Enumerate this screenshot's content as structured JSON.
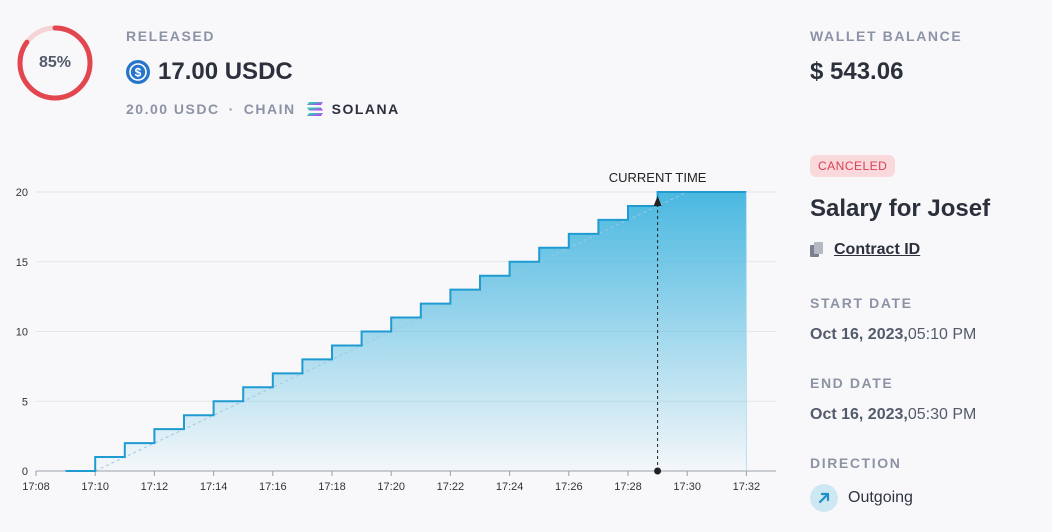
{
  "progress": {
    "percent": 85,
    "label": "85%",
    "color": "#e2474f",
    "track_color": "#f6d4d6"
  },
  "released": {
    "label": "RELEASED",
    "amount": "17.00 USDC",
    "icon": "usdc-icon",
    "total": "20.00 USDC",
    "separator": "·",
    "chain_label": "CHAIN",
    "chain_icon": "solana-icon",
    "chain_name": "SOLANA"
  },
  "wallet": {
    "label": "WALLET BALANCE",
    "value": "$ 543.06"
  },
  "stream": {
    "status": "CANCELED",
    "title": "Salary for Josef",
    "contract_label": "Contract ID",
    "contract_icon": "copy-icon",
    "start_label": "START DATE",
    "start_date": "Oct 16, 2023,",
    "start_time": "05:10 PM",
    "end_label": "END DATE",
    "end_date": "Oct 16, 2023,",
    "end_time": "05:30 PM",
    "direction_label": "DIRECTION",
    "direction_icon": "arrow-up-right-icon",
    "direction_value": "Outgoing"
  },
  "chart_data": {
    "type": "area",
    "title": "",
    "xlabel": "",
    "ylabel": "",
    "x_ticks": [
      "17:08",
      "17:10",
      "17:12",
      "17:14",
      "17:16",
      "17:18",
      "17:20",
      "17:22",
      "17:24",
      "17:26",
      "17:28",
      "17:30",
      "17:32"
    ],
    "y_ticks": [
      0,
      5,
      10,
      15,
      20
    ],
    "xlim_minutes": [
      0,
      25
    ],
    "ylim": [
      0,
      20
    ],
    "x_start": "17:08",
    "series": [
      {
        "step_x": [
          "17:09",
          "17:10",
          "17:11",
          "17:12",
          "17:13",
          "17:14",
          "17:15",
          "17:16",
          "17:17",
          "17:18",
          "17:19",
          "17:20",
          "17:21",
          "17:22",
          "17:23",
          "17:24",
          "17:25",
          "17:26",
          "17:27",
          "17:28",
          "17:29",
          "17:30",
          "17:32"
        ],
        "step_y": [
          0,
          0,
          1,
          2,
          3,
          4,
          5,
          6,
          7,
          8,
          9,
          10,
          11,
          12,
          13,
          14,
          15,
          16,
          17,
          18,
          19,
          20,
          20
        ]
      }
    ],
    "linear_line": {
      "x": [
        "17:10",
        "17:30"
      ],
      "y": [
        0,
        20
      ]
    },
    "current_time": {
      "x": "17:29",
      "label": "CURRENT TIME"
    },
    "grid": "horizontal",
    "line_color": "#1f9bd1",
    "fill_color": "#4ab8e0"
  }
}
